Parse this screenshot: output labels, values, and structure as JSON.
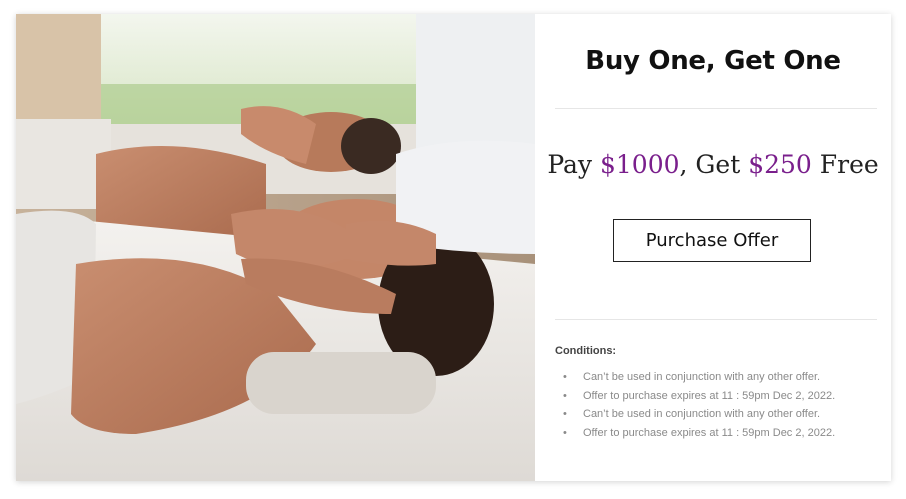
{
  "photo": {
    "alt_description_icon": "spa-massage-image"
  },
  "offer_card": {
    "title": "Buy One, Get One",
    "offer_prefix": "Pay",
    "offer_pay_amount": "$1000",
    "offer_mid": ", Get",
    "offer_free_amount": "$250",
    "offer_suffix": "Free",
    "purchase_button": "Purchase Offer",
    "conditions_label": "Conditions:",
    "conditions": [
      "Can’t be used in conjunction with any other offer.",
      "Offer to purchase expires at 11 : 59pm Dec 2, 2022.",
      "Can’t be used in conjunction with any other offer.",
      "Offer to purchase expires at 11 : 59pm Dec 2, 2022."
    ],
    "bullet": "•"
  },
  "colors": {
    "accent": "#7a1f8c",
    "text": "#111111",
    "muted": "#8a8a8a",
    "divider": "#e6e6e6"
  }
}
